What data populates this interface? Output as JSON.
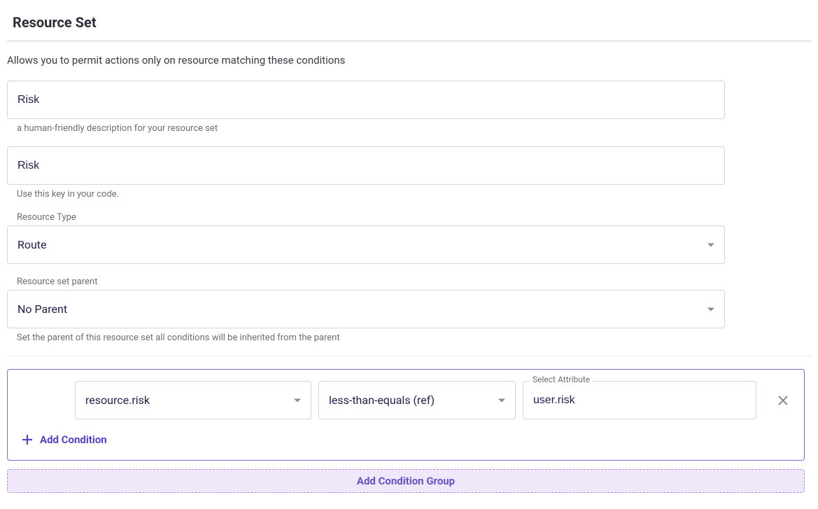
{
  "section": {
    "title": "Resource Set",
    "description": "Allows you to permit actions only on resource matching these conditions"
  },
  "fields": {
    "name": {
      "value": "Risk",
      "helper": "a human-friendly description for your resource set"
    },
    "key": {
      "value": "Risk",
      "helper": "Use this key in your code."
    },
    "resource_type": {
      "label": "Resource Type",
      "value": "Route"
    },
    "parent": {
      "label": "Resource set parent",
      "value": "No Parent",
      "helper": "Set the parent of this resource set all conditions will be inherited from the parent"
    }
  },
  "conditions": {
    "rows": [
      {
        "attribute": "resource.risk",
        "operator": "less-than-equals (ref)",
        "value_label": "Select Attribute",
        "value": "user.risk"
      }
    ],
    "add_condition_label": "Add Condition",
    "add_group_label": "Add Condition Group"
  }
}
